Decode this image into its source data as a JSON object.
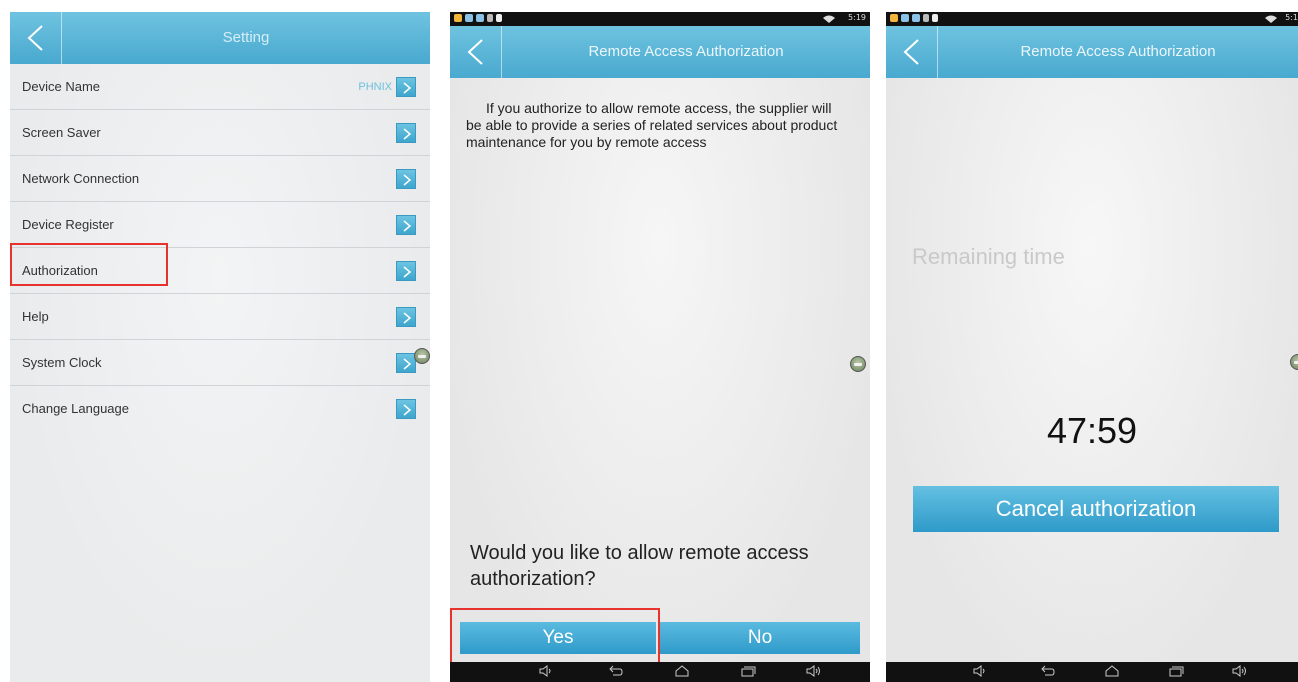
{
  "settings_panel": {
    "title": "Setting",
    "items": [
      {
        "label": "Device Name",
        "value": "PHNIX"
      },
      {
        "label": "Screen Saver",
        "value": ""
      },
      {
        "label": "Network Connection",
        "value": ""
      },
      {
        "label": "Device Register",
        "value": ""
      },
      {
        "label": "Authorization",
        "value": ""
      },
      {
        "label": "Help",
        "value": ""
      },
      {
        "label": "System Clock",
        "value": ""
      },
      {
        "label": "Change Language",
        "value": ""
      }
    ]
  },
  "authorization_prompt": {
    "status_time": "5:19",
    "title": "Remote Access Authorization",
    "description": "If you authorize to allow remote access, the supplier will be able to provide a series of related services about product maintenance for you by remote access",
    "question": "Would you like to allow remote access authorization?",
    "yes_label": "Yes",
    "no_label": "No"
  },
  "authorization_active": {
    "status_time": "5:1",
    "title": "Remote Access Authorization",
    "remaining_label": "Remaining time",
    "countdown": "47:59",
    "cancel_label": "Cancel authorization"
  },
  "colors": {
    "accent": "#49a9cf",
    "highlight_border": "#e8322e"
  },
  "icons": [
    "back-chevron-icon",
    "chevron-right-icon",
    "volume-down-icon",
    "back-icon",
    "home-icon",
    "recent-apps-icon",
    "volume-up-icon"
  ]
}
